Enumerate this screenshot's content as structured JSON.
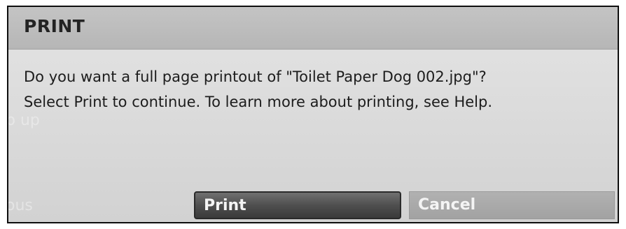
{
  "dialog": {
    "title": "PRINT",
    "message_line1": "Do you want a full page printout of \"Toilet Paper Dog 002.jpg\"?",
    "message_line2": "Select Print to continue. To learn more about printing, see Help.",
    "buttons": {
      "print_label": "Print",
      "cancel_label": "Cancel"
    },
    "background_ghost_text": [
      "p up",
      "ous"
    ]
  },
  "colors": {
    "title_bar": "#bdbdbd",
    "dialog_body": "#dcdcdc",
    "primary_button": "#4f4f4f",
    "secondary_button": "#a8a8a8",
    "border": "#0e0e0e"
  }
}
